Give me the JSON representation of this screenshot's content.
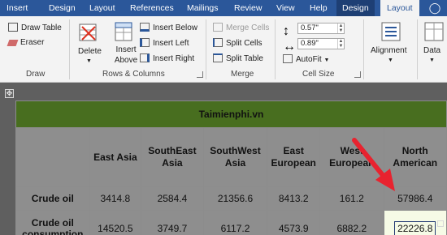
{
  "ribbon_tabs": [
    "Insert",
    "Design",
    "Layout",
    "References",
    "Mailings",
    "Review",
    "View",
    "Help",
    "Design",
    "Layout"
  ],
  "ribbon": {
    "draw": {
      "draw_table": "Draw Table",
      "eraser": "Eraser",
      "group": "Draw"
    },
    "rows_columns": {
      "delete": "Delete",
      "insert_above": "Insert Above",
      "insert_below": "Insert Below",
      "insert_left": "Insert Left",
      "insert_right": "Insert Right",
      "group": "Rows & Columns"
    },
    "merge": {
      "merge_cells": "Merge Cells",
      "split_cells": "Split Cells",
      "split_table": "Split Table",
      "group": "Merge"
    },
    "cell_size": {
      "height": "0.57\"",
      "width": "0.89\"",
      "autofit": "AutoFit",
      "group": "Cell Size"
    },
    "alignment": "Alignment",
    "data": "Data"
  },
  "table": {
    "title": "Taimienphi.vn",
    "headers": [
      "East Asia",
      "SouthEast Asia",
      "SouthWest Asia",
      "East European",
      "West European",
      "North American"
    ],
    "rows": [
      {
        "label": "Crude oil",
        "values": [
          "3414.8",
          "2584.4",
          "21356.6",
          "8413.2",
          "161.2",
          "57986.4"
        ]
      },
      {
        "label": "Crude oil consumption",
        "values": [
          "14520.5",
          "3749.7",
          "6117.2",
          "4573.9",
          "6882.2",
          "22226.8"
        ]
      }
    ]
  },
  "colors": {
    "tab_bar": "#2b579a",
    "title_row": "#486e1f",
    "highlight": "#f6fbe6",
    "arrow": "#e8232f"
  }
}
